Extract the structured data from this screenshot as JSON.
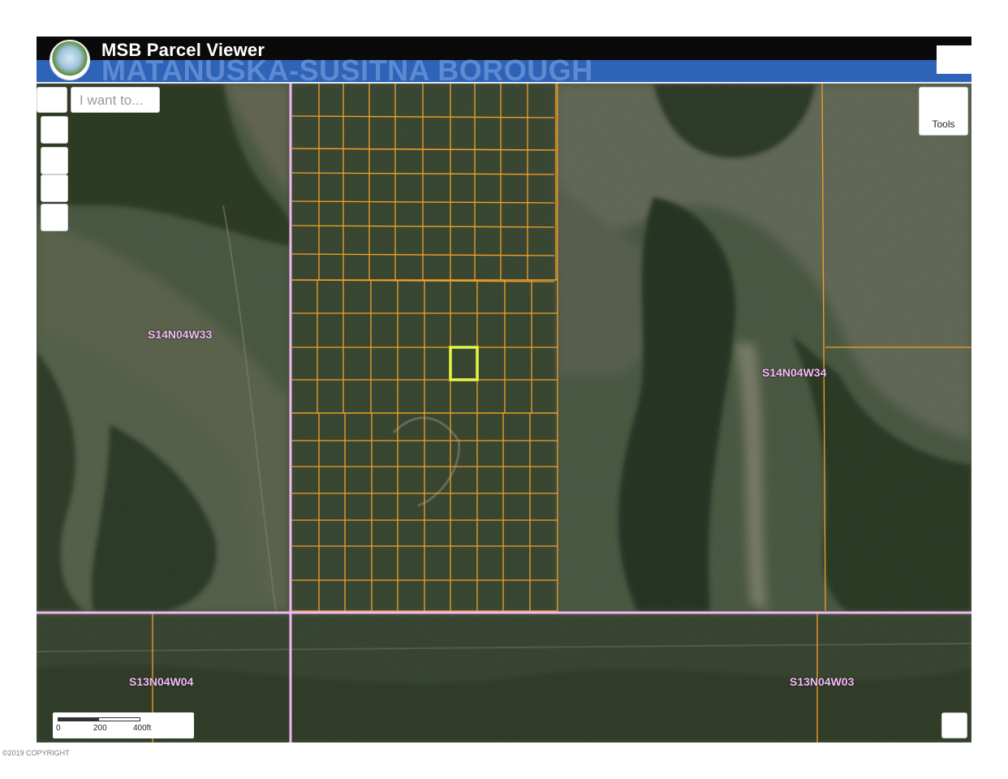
{
  "header": {
    "app_title": "MSB Parcel Viewer",
    "borough_title": "MATANUSKA-SUSITNA BOROUGH",
    "logo": "borough-seal-logo"
  },
  "search": {
    "placeholder": "I want to..."
  },
  "toolbar": {
    "tools_label": "Tools"
  },
  "map": {
    "section_labels": [
      "S14N04W33",
      "S14N04W34",
      "S13N04W04",
      "S13N04W03"
    ],
    "parcel_line_color": "#f5a02a",
    "section_line_color": "#f2b8f2",
    "selected_parcel_color": "#e6f542",
    "imagery": "aerial-forest-wetland"
  },
  "scale_bar": {
    "ticks": [
      "0",
      "200",
      "400ft"
    ]
  },
  "footer": {
    "copyright": "©2019 COPYRIGHT"
  }
}
